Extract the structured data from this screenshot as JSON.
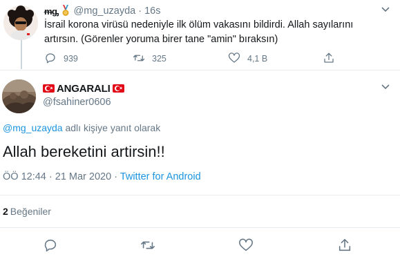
{
  "parent_tweet": {
    "display_name": "ᵯᶃ",
    "handle": "@mg_uzayda",
    "separator": "·",
    "time": "16s",
    "text": "İsrail korona virüsü nedeniyle ilk ölüm vakasını bildirdi. Allah sayılarını artırsın. (Görenler yoruma birer tane \"amin\" bıraksın)",
    "actions": {
      "reply_count": "939",
      "retweet_count": "325",
      "like_count": "4,1 B"
    }
  },
  "main_tweet": {
    "display_name": "ANGARALI",
    "handle": "@fsahiner0606",
    "reply_mention": "@mg_uzayda",
    "reply_suffix": " adlı kişiye yanıt olarak",
    "text": "Allah bereketini artirsin!!",
    "timestamp": "ÖÖ 12:44 · 21 Mar 2020 · ",
    "source": "Twitter for Android",
    "like_count": "2",
    "likes_label": "Beğeniler"
  },
  "colors": {
    "link": "#1b95e0",
    "secondary_text": "#657786",
    "divider": "#e6ecf0",
    "flag_red": "#e30a17"
  },
  "icons": [
    "chevron-down-icon",
    "reply-icon",
    "retweet-icon",
    "like-icon",
    "share-icon",
    "medal-icon",
    "turkey-flag-icon"
  ]
}
